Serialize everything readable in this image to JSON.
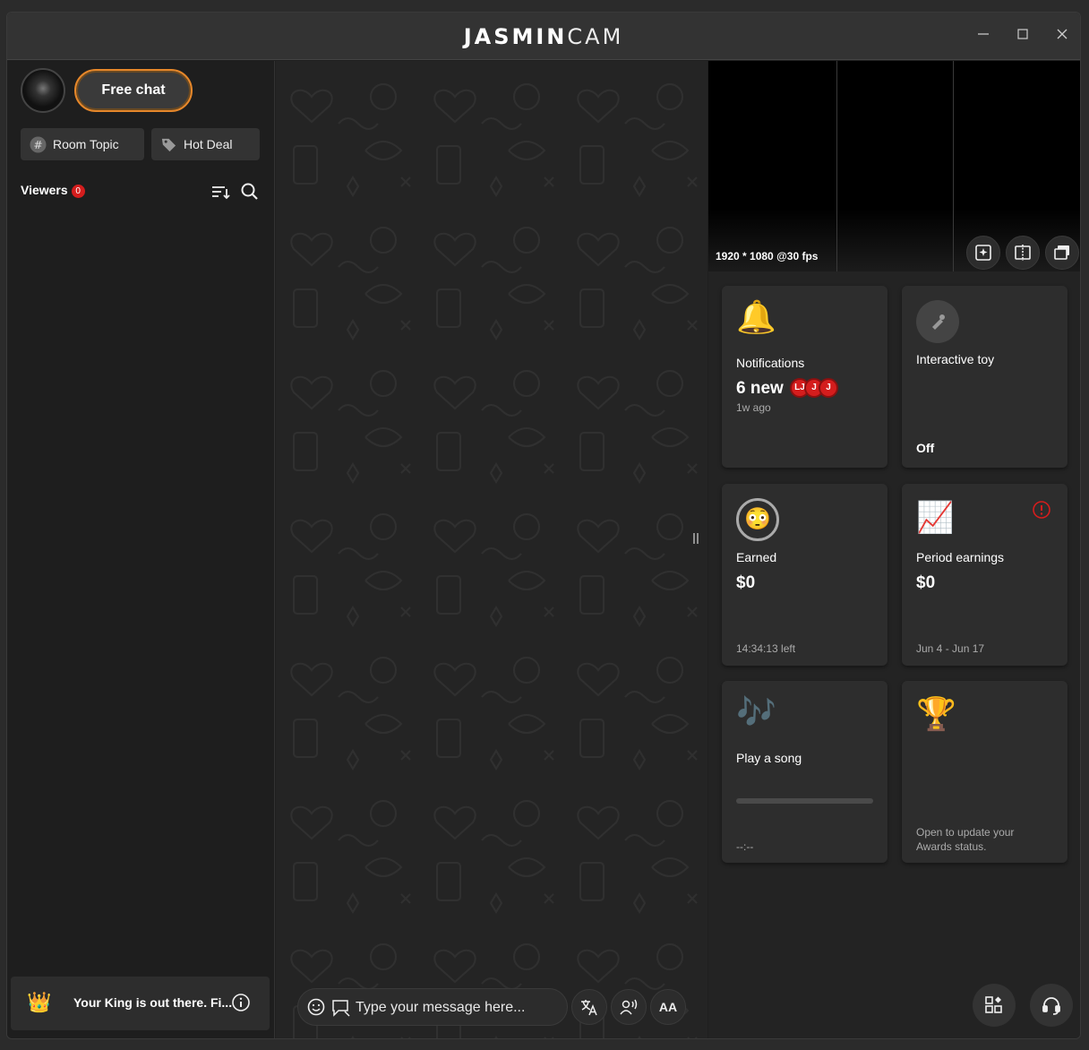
{
  "app": {
    "brand_bold": "JASMIN",
    "brand_light": "CAM"
  },
  "window_controls": {
    "minimize": "—",
    "maximize": "☐",
    "close": "✕"
  },
  "sidebar": {
    "free_chat_label": "Free chat",
    "room_topic_label": "Room Topic",
    "hot_deal_label": "Hot Deal",
    "viewers_label": "Viewers",
    "viewers_count": "0",
    "king_text": "Your King is out there. Fi..."
  },
  "chat": {
    "placeholder": "Type your message here...",
    "font_size_label": "AA"
  },
  "video": {
    "resolution": "1920 * 1080 @30 fps"
  },
  "cards": {
    "notifications": {
      "label": "Notifications",
      "count": "6 new",
      "time": "1w ago",
      "avatars": [
        "LJ",
        "J",
        "J"
      ]
    },
    "toy": {
      "label": "Interactive toy",
      "status": "Off"
    },
    "earned": {
      "label": "Earned",
      "value": "$0",
      "time_left": "14:34:13 left"
    },
    "period": {
      "label": "Period earnings",
      "value": "$0",
      "range": "Jun 4 - Jun 17"
    },
    "song": {
      "label": "Play a song",
      "time": "--:--"
    },
    "awards": {
      "text": "Open to update your Awards status."
    }
  },
  "colors": {
    "accent": "#e6872a",
    "badge": "#d41d1d",
    "panel": "#2d2d2d"
  }
}
